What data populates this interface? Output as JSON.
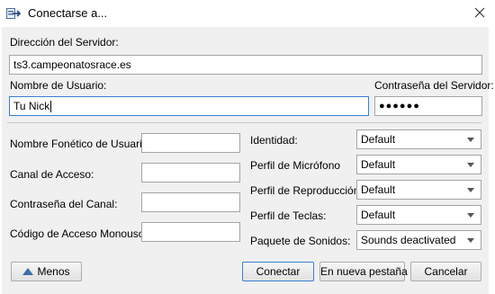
{
  "window": {
    "title": "Conectarse a..."
  },
  "server": {
    "address_label": "Dirección del Servidor:",
    "address_value": "ts3.campeonatosrace.es"
  },
  "user": {
    "nick_label": "Nombre de Usuario:",
    "nick_value": "Tu Nick",
    "server_password_label": "Contraseña del Servidor:",
    "server_password_value": "●●●●●●"
  },
  "left_fields": {
    "phonetic_label": "Nombre Fonético de Usuario:",
    "channel_label": "Canal de Acceso:",
    "channel_password_label": "Contraseña del Canal:",
    "one_time_key_label": "Código de Acceso Monouso:"
  },
  "right_fields": {
    "identity_label": "Identidad:",
    "identity_value": "Default",
    "mic_profile_label": "Perfil de Micrófono",
    "mic_profile_value": "Default",
    "playback_profile_label": "Perfil de Reproducción:",
    "playback_profile_value": "Default",
    "hotkey_profile_label": "Perfil de Teclas:",
    "hotkey_profile_value": "Default",
    "sound_pack_label": "Paquete de Sonidos:",
    "sound_pack_value": "Sounds deactivated"
  },
  "buttons": {
    "less": "Menos",
    "connect": "Conectar",
    "new_tab": "En nueva pestaña",
    "cancel": "Cancelar"
  },
  "icons": {
    "app": "teamspeak-connect-icon",
    "close": "close-icon",
    "dropdown": "chevron-down-icon",
    "less": "triangle-up-icon"
  },
  "colors": {
    "focus_border": "#3b7fd0",
    "dialog_bg": "#f0f0f0"
  }
}
